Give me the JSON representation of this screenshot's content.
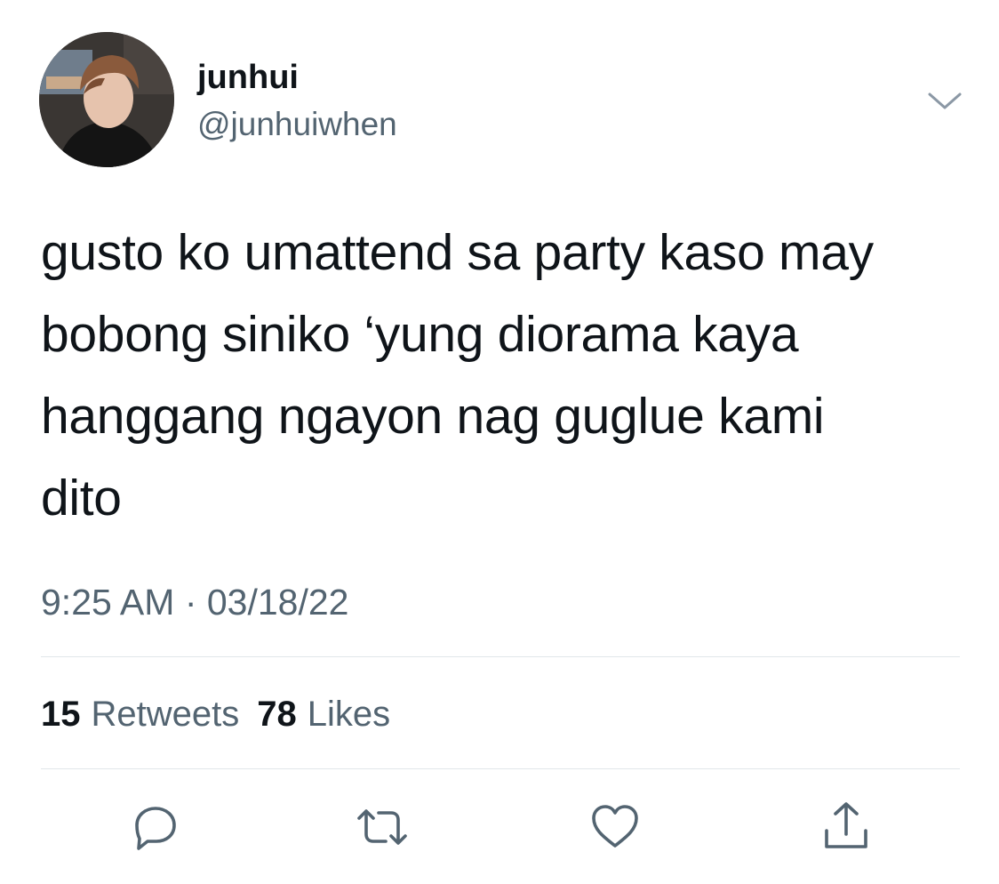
{
  "tweet": {
    "author": {
      "display_name": "junhui",
      "handle": "@junhuiwhen",
      "avatar_icon": "profile-photo"
    },
    "text_lines": [
      "gusto ko umattend sa party kaso may",
      "bobong siniko ‘yung diorama kaya",
      "hanggang ngayon nag guglue kami",
      "dito"
    ],
    "timestamp": "9:25 AM · 03/18/22",
    "stats": {
      "retweets_count": "15",
      "retweets_label": "Retweets",
      "likes_count": "78",
      "likes_label": "Likes"
    },
    "actions": {
      "reply_icon": "reply-icon",
      "retweet_icon": "retweet-icon",
      "like_icon": "heart-icon",
      "share_icon": "share-icon"
    },
    "more_icon": "chevron-down-icon"
  },
  "colors": {
    "text_primary": "#0f1419",
    "text_secondary": "#536471",
    "divider": "#e1e6ea",
    "icon": "#536471"
  }
}
